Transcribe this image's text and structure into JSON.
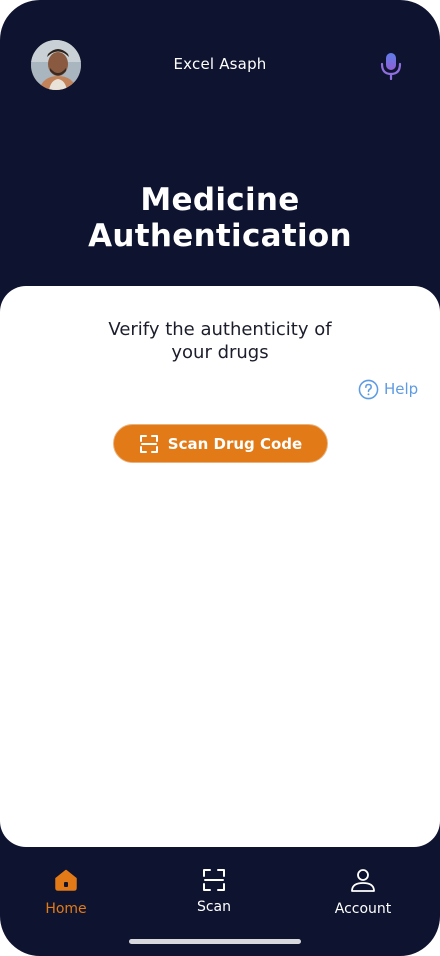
{
  "header": {
    "user_name": "Excel Asaph",
    "avatar_icon": "user-avatar",
    "mic_icon": "microphone-icon"
  },
  "hero": {
    "title_line1": "Medicine",
    "title_line2": "Authentication"
  },
  "card": {
    "verify_line1": "Verify the authenticity of",
    "verify_line2": "your drugs",
    "help_label": "Help",
    "help_icon": "question-circle-icon",
    "scan_button_label": "Scan Drug Code",
    "scan_button_icon": "scan-frame-icon"
  },
  "bottom_nav": {
    "items": [
      {
        "label": "Home",
        "icon": "home-icon",
        "active": true
      },
      {
        "label": "Scan",
        "icon": "scan-frame-icon",
        "active": false
      },
      {
        "label": "Account",
        "icon": "user-icon",
        "active": false
      }
    ]
  },
  "colors": {
    "background": "#0e1330",
    "accent": "#e27a17",
    "help": "#5e9be3",
    "card": "#ffffff"
  }
}
